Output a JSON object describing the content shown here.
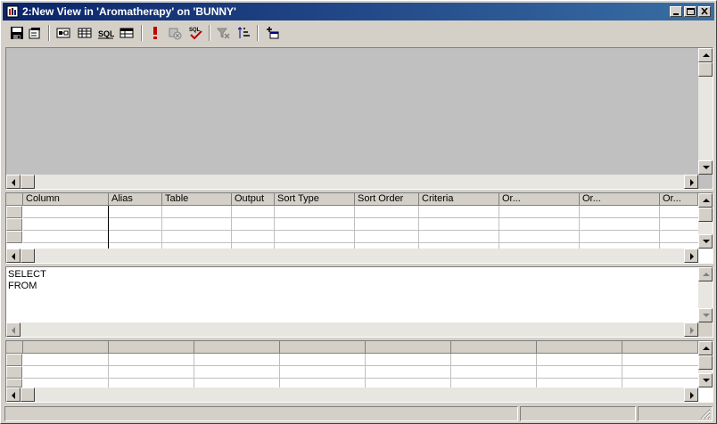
{
  "window": {
    "title": "2:New View in 'Aromatherapy' on 'BUNNY'",
    "titlebar_color": "#0a246a",
    "controls": [
      "minimize-icon",
      "maximize-icon",
      "close-icon"
    ]
  },
  "toolbar": {
    "buttons": [
      {
        "name": "save-button",
        "icon": "floppy-disk-icon"
      },
      {
        "name": "properties-button",
        "icon": "properties-icon"
      },
      {
        "name": "show-diagram-pane-button",
        "icon": "diagram-pane-icon"
      },
      {
        "name": "show-grid-pane-button",
        "icon": "grid-pane-icon"
      },
      {
        "name": "show-sql-pane-button",
        "icon": "sql-pane-icon",
        "label": "SQL"
      },
      {
        "name": "show-results-pane-button",
        "icon": "results-pane-icon"
      },
      {
        "name": "run-button",
        "icon": "exclamation-icon"
      },
      {
        "name": "cancel-query-button",
        "icon": "cancel-query-icon"
      },
      {
        "name": "verify-sql-button",
        "icon": "sql-check-icon",
        "label": "SQL"
      },
      {
        "name": "remove-filter-button",
        "icon": "remove-filter-icon"
      },
      {
        "name": "sort-button",
        "icon": "sort-icon"
      },
      {
        "name": "add-table-button",
        "icon": "add-table-icon"
      }
    ]
  },
  "grid_pane": {
    "columns": [
      "Column",
      "Alias",
      "Table",
      "Output",
      "Sort Type",
      "Sort Order",
      "Criteria",
      "Or...",
      "Or...",
      "Or..."
    ]
  },
  "sql_pane": {
    "text": "SELECT\nFROM"
  },
  "colors": {
    "face": "#d4d0c8",
    "diagram_bg": "#c0c0c0",
    "window_bg": "#ffffff"
  }
}
